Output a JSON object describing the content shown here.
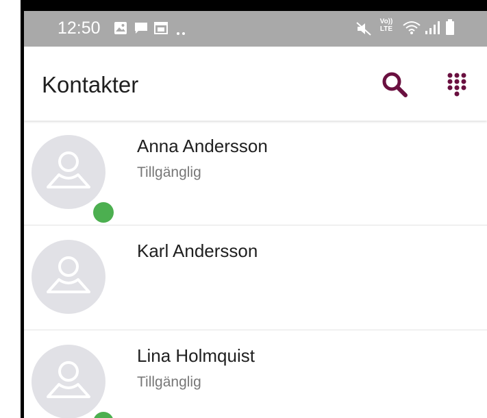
{
  "status_bar": {
    "time": "12:50",
    "left_icons": [
      "gallery-icon",
      "message-icon",
      "calendar-icon",
      "more-dots-icon"
    ],
    "right_icons": [
      "mute-icon",
      "volte-icon",
      "wifi-icon",
      "signal-icon",
      "battery-icon"
    ],
    "volte_top": "Vo))",
    "volte_bottom": "LTE"
  },
  "app_bar": {
    "title": "Kontakter",
    "accent_color": "#6a1040"
  },
  "contacts": [
    {
      "name": "Anna Andersson",
      "status": "Tillgänglig",
      "online": true
    },
    {
      "name": "Karl Andersson",
      "status": "",
      "online": false
    },
    {
      "name": "Lina Holmquist",
      "status": "Tillgänglig",
      "online": true
    }
  ],
  "colors": {
    "status_bar_bg": "#a9a9a9",
    "presence_online": "#4caf50",
    "avatar_bg": "#e1e1e6"
  }
}
